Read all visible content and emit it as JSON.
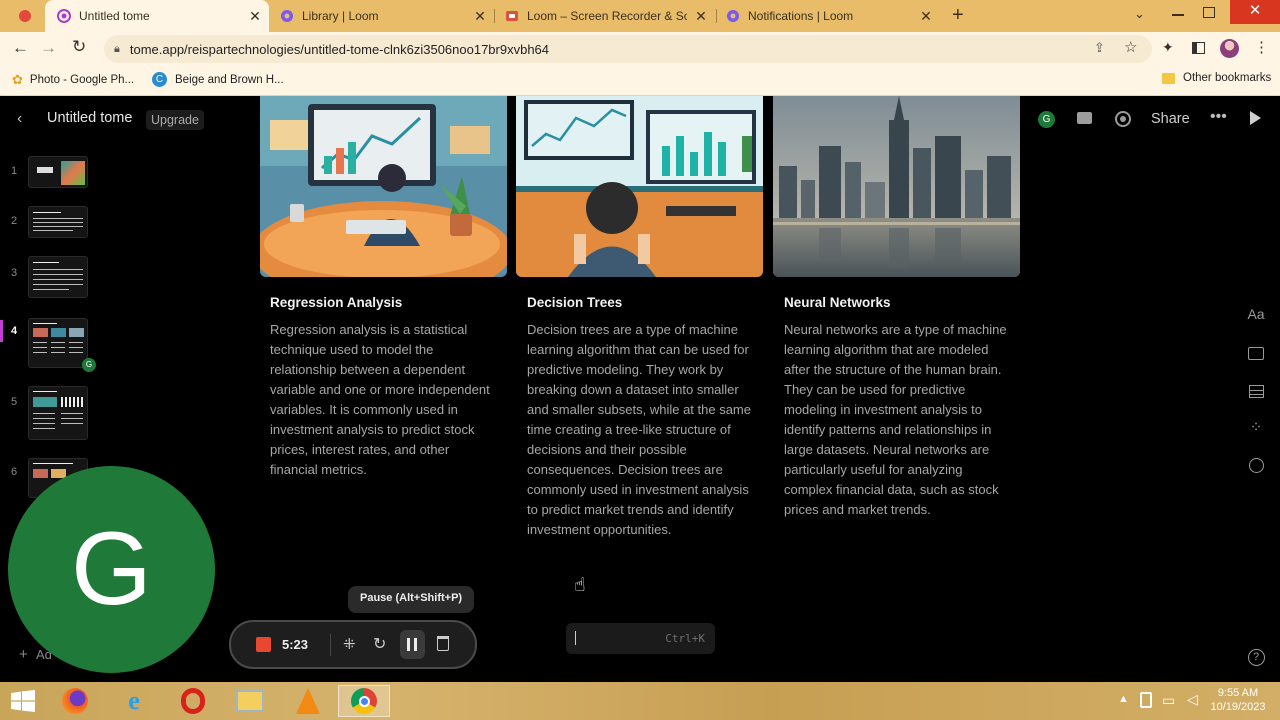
{
  "browser": {
    "tabs": [
      {
        "title": "Untitled tome",
        "active": true
      },
      {
        "title": "Library | Loom",
        "active": false
      },
      {
        "title": "Loom – Screen Recorder & Scree",
        "active": false
      },
      {
        "title": "Notifications | Loom",
        "active": false
      }
    ],
    "url": "tome.app/reispartechnologies/untitled-tome-clnk6zi3506noo17br9xvbh64",
    "bookmarks": [
      "Photo - Google Ph...",
      "Beige and Brown H..."
    ],
    "other_bookmarks": "Other bookmarks"
  },
  "app": {
    "doc_title": "Untitled tome",
    "upgrade_label": "Upgrade",
    "share_label": "Share",
    "user_initial": "G",
    "slide_numbers": [
      "1",
      "2",
      "3",
      "4",
      "5",
      "6"
    ],
    "active_slide": "4",
    "add_label": "Ad",
    "cards": [
      {
        "title": "Regression Analysis",
        "body": "Regression analysis is a statistical technique used to model the relationship between a dependent variable and one or more independent variables. It is commonly used in investment analysis to predict stock prices, interest rates, and other financial metrics."
      },
      {
        "title": "Decision Trees",
        "body": "Decision trees are a type of machine learning algorithm that can be used for predictive modeling. They work by breaking down a dataset into smaller and smaller subsets, while at the same time creating a tree-like structure of decisions and their possible consequences. Decision trees are commonly used in investment analysis to predict market trends and identify investment opportunities."
      },
      {
        "title": "Neural Networks",
        "body": "Neural networks are a type of machine learning algorithm that are modeled after the structure of the human brain. They can be used for predictive modeling in investment analysis to identify patterns and relationships in large datasets. Neural networks are particularly useful for analyzing complex financial data, such as stock prices and market trends."
      }
    ],
    "side_tools": {
      "text_label": "Aa"
    },
    "command_shortcut": "Ctrl+K"
  },
  "recorder": {
    "webcam_initial": "G",
    "tooltip": "Pause (Alt+Shift+P)",
    "time": "5:23"
  },
  "taskbar": {
    "time": "9:55 AM",
    "date": "10/19/2023"
  },
  "colors": {
    "chrome_frame": "#e9bc6a",
    "chrome_toolbar": "#fff5e4",
    "app_bg": "#000000",
    "webcam_bubble": "#1f7a3a",
    "record_red": "#e8482f",
    "active_slide_accent": "#c43fd6"
  }
}
